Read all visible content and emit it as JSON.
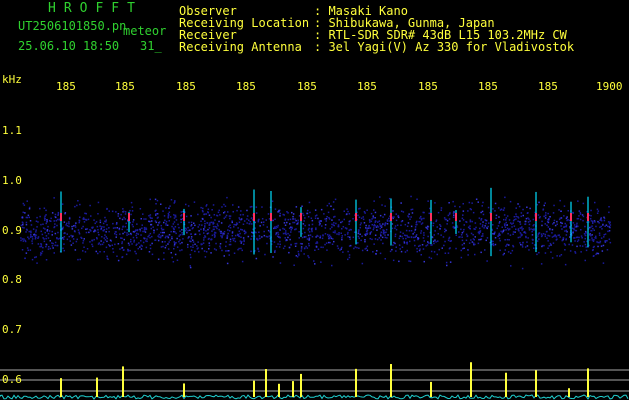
{
  "header": {
    "title": "HROFFT",
    "filename": "UT2506101850.pn",
    "mode": "meteor",
    "datetime": "25.06.10 18:50",
    "count": "31_"
  },
  "info": [
    {
      "label": "Observer",
      "value": ": Masaki Kano"
    },
    {
      "label": "Receiving Location",
      "value": ": Shibukawa, Gunma, Japan"
    },
    {
      "label": "Receiver",
      "value": ": RTL-SDR SDR# 43dB L15 103.2MHz CW"
    },
    {
      "label": "Receiving Antenna",
      "value": ": 3el Yagi(V) Az 330 for Vladivostok"
    }
  ],
  "axis": {
    "y_unit": "kHz",
    "y_ticks": [
      "1.1",
      "1.0",
      "0.9",
      "0.8",
      "0.7",
      "0.6"
    ],
    "x_ticks": [
      "185",
      "185",
      "185",
      "185",
      "185",
      "185",
      "185",
      "185",
      "185",
      "1900"
    ]
  },
  "colors": {
    "text": "#2fd12f",
    "axis": "#ffff3c",
    "noise": "#1a1a9c",
    "echo_core": "#ff3060",
    "echo_edge": "#00e0ff"
  }
}
